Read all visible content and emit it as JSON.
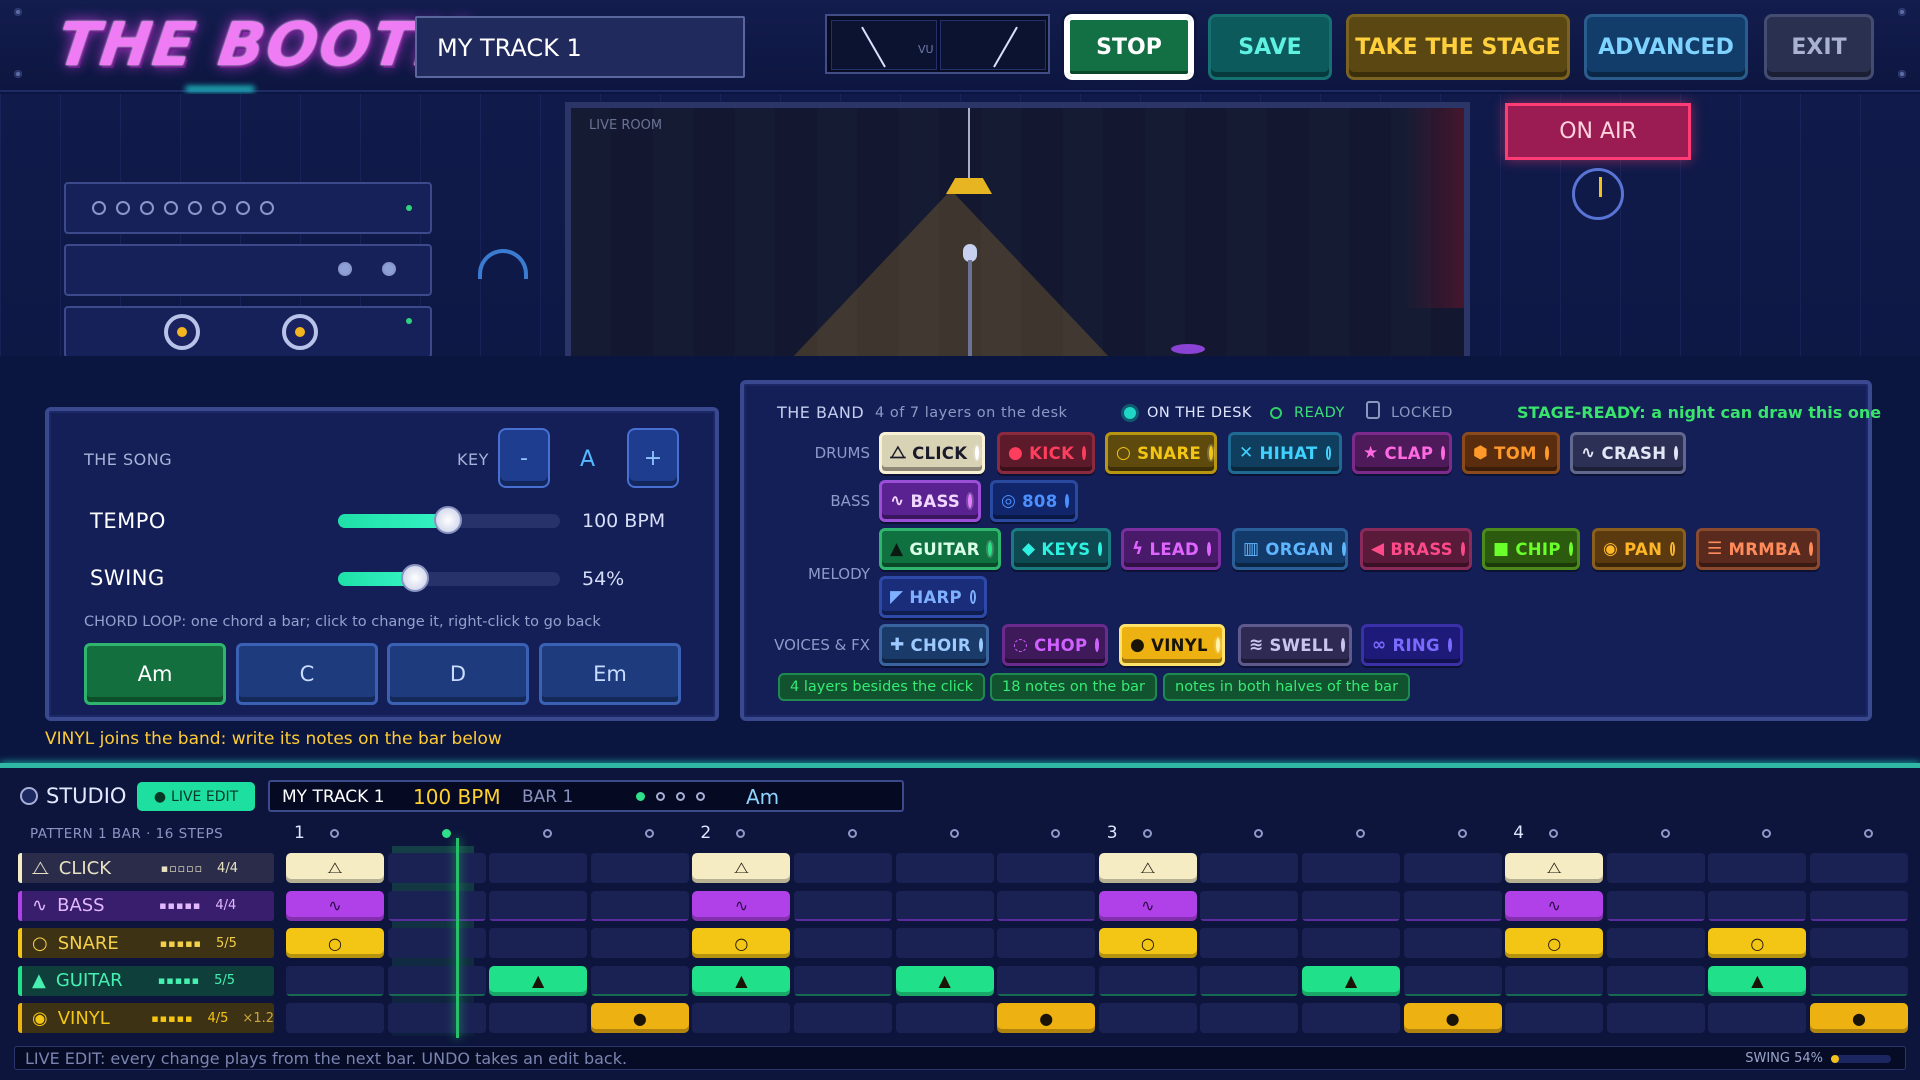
{
  "app": {
    "title": "THE BOOTH",
    "track_name": "MY TRACK 1"
  },
  "vu": {
    "label": "VU"
  },
  "toolbar": {
    "stop": "STOP",
    "save": "SAVE",
    "stage": "TAKE THE STAGE",
    "advanced": "ADVANCED",
    "exit": "EXIT"
  },
  "scene": {
    "live_room_label": "LIVE ROOM",
    "on_air": "ON AIR"
  },
  "song": {
    "title": "THE SONG",
    "key_label": "KEY",
    "key_minus": "-",
    "key_value": "A",
    "key_plus": "+",
    "tempo_label": "TEMPO",
    "tempo_value": "100 BPM",
    "tempo_level": 0.45,
    "swing_label": "SWING",
    "swing_value": "54%",
    "swing_level": 0.3,
    "chord_hint": "CHORD LOOP: one chord a bar; click to change it, right-click to go back",
    "chords": [
      "Am",
      "C",
      "D",
      "Em"
    ],
    "notice": "VINYL joins the band: write its notes on the bar below"
  },
  "band": {
    "title": "THE BAND",
    "count": "4 of 7 layers on the desk",
    "legend": {
      "on_desk": "ON THE DESK",
      "ready": "READY",
      "locked": "LOCKED"
    },
    "stage_ready": "STAGE-READY: a night can draw this one",
    "rows": {
      "drums": "DRUMS",
      "bass": "BASS",
      "melody": "MELODY",
      "voices": "VOICES & FX"
    },
    "drums": [
      "CLICK",
      "KICK",
      "SNARE",
      "HIHAT",
      "CLAP",
      "TOM",
      "CRASH"
    ],
    "bass": [
      "BASS",
      "808"
    ],
    "melody": [
      "GUITAR",
      "KEYS",
      "LEAD",
      "ORGAN",
      "BRASS",
      "CHIP",
      "PAN",
      "MRMBA",
      "HARP"
    ],
    "voices": [
      "CHOIR",
      "CHOP",
      "VINYL",
      "SWELL",
      "RING"
    ],
    "tags": [
      "4 layers besides the click",
      "18 notes on the bar",
      "notes in both halves of the bar"
    ]
  },
  "studio": {
    "title": "STUDIO",
    "live_edit": "LIVE EDIT",
    "info": {
      "track": "MY TRACK 1",
      "bpm": "100 BPM",
      "bar": "BAR 1",
      "chord": "Am"
    },
    "pattern_label": "PATTERN   1 BAR · 16 STEPS",
    "beats": [
      "1",
      "2",
      "3",
      "4"
    ],
    "tracks": [
      {
        "name": "CLICK",
        "level": "▪▫▫▫▫",
        "frac": "4/4",
        "extra": ""
      },
      {
        "name": "BASS",
        "level": "▪▪▪▪▪",
        "frac": "4/4",
        "extra": ""
      },
      {
        "name": "SNARE",
        "level": "▪▪▪▪▪",
        "frac": "5/5",
        "extra": ""
      },
      {
        "name": "GUITAR",
        "level": "▪▪▪▪▪",
        "frac": "5/5",
        "extra": ""
      },
      {
        "name": "VINYL",
        "level": "▪▪▪▪▪",
        "frac": "4/5",
        "extra": "×1.2"
      }
    ],
    "status": "LIVE EDIT: every change plays from the next bar. UNDO takes an edit back.",
    "swing_status": "SWING 54%"
  },
  "colors": {
    "click": "#f5ecc4",
    "bass": "#b040e8",
    "snare": "#f3c515",
    "guitar": "#20e08a",
    "vinyl": "#eeb112"
  }
}
